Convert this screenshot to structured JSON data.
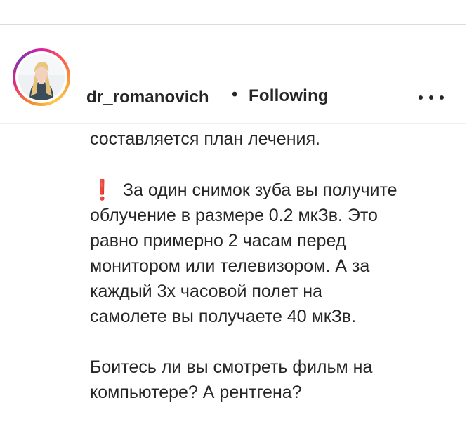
{
  "post": {
    "username": "dr_romanovich",
    "separator": "•",
    "follow_status": "Following",
    "more_icon": "more-horizontal-icon",
    "avatar_icon": "profile-photo"
  },
  "caption": {
    "line_1": "составляется план лечения.",
    "warning_icon": "❗",
    "para_2": [
      "За один снимок зуба вы получите",
      "облучение в размере 0.2 мкЗв. Это",
      "равно примерно 2 часам перед",
      "монитором или телевизором. А за",
      "каждый 3х часовой полет на",
      "самолете вы получаете 40 мкЗв."
    ],
    "para_3": [
      "Боитесь ли вы смотреть фильм на",
      "компьютере? А рентгена?"
    ]
  },
  "colors": {
    "text": "#262626",
    "border": "#dbdbdb",
    "warning": "#e0252b"
  }
}
